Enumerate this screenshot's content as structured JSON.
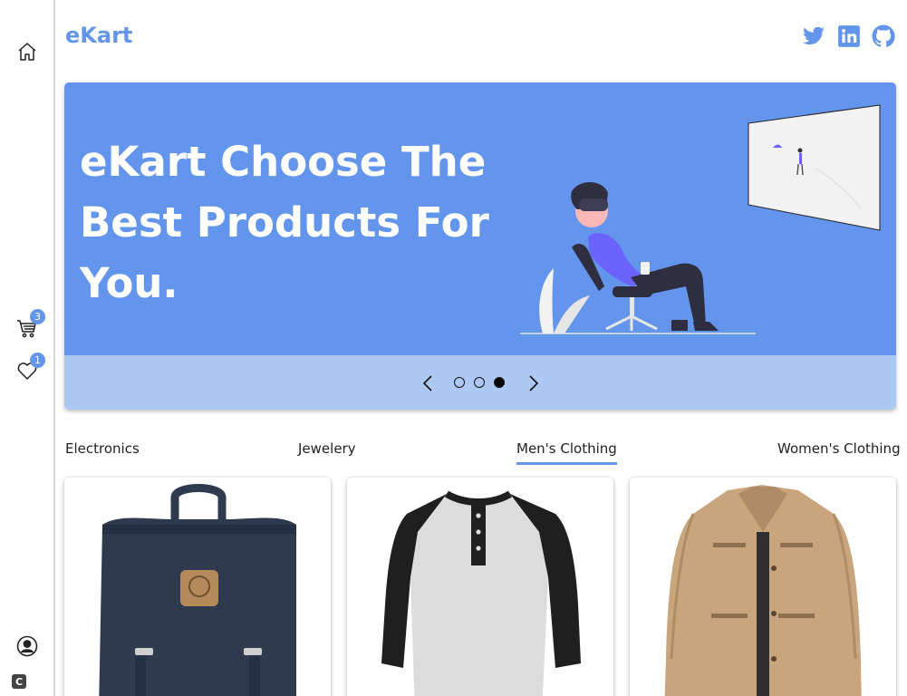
{
  "app": {
    "brand": "eKart"
  },
  "sidebar": {
    "cart_count": "3",
    "wishlist_count": "1",
    "bottom_logo": "C",
    "icons": [
      "home-icon",
      "cart-icon",
      "heart-icon",
      "user-icon"
    ]
  },
  "header": {
    "social": [
      "twitter-icon",
      "linkedin-icon",
      "github-icon"
    ]
  },
  "banner": {
    "title": "eKart Choose The Best Products For You.",
    "slides": 3,
    "active_slide": 3
  },
  "categories": {
    "tabs": [
      "Electronics",
      "Jewelery",
      "Men's Clothing",
      "Women's Clothing"
    ],
    "active": "Men's Clothing"
  },
  "products": [
    {
      "image": "backpack"
    },
    {
      "image": "raglan-henley-shirt"
    },
    {
      "image": "khaki-jacket"
    }
  ],
  "colors": {
    "accent": "#6495ed",
    "banner_bottom": "#adc8f3"
  }
}
